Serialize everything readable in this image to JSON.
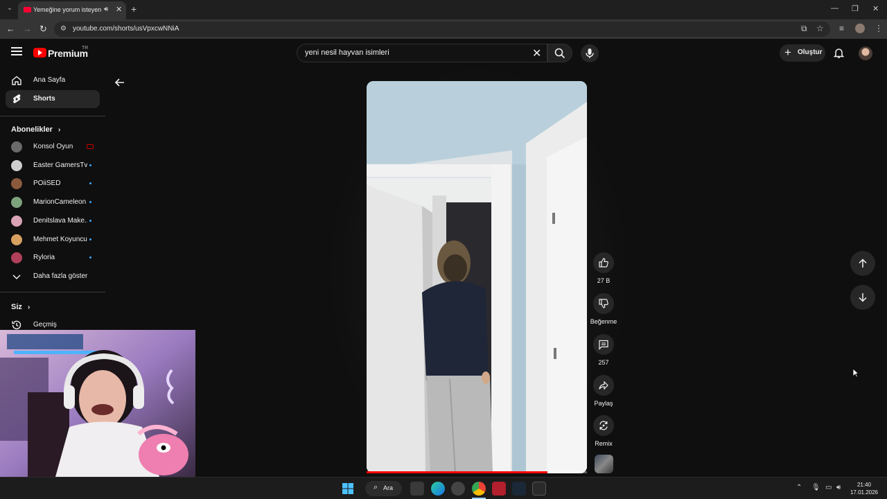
{
  "browser": {
    "tab_title": "Yemeğine yorum isteyen anne",
    "url": "youtube.com/shorts/usVpxcwNNiA"
  },
  "header": {
    "logo_text": "Premium",
    "logo_region": "TR",
    "search_value": "yeni nesil hayvan isimleri",
    "create_label": "Oluştur"
  },
  "sidebar": {
    "home_label": "Ana Sayfa",
    "shorts_label": "Shorts",
    "subscriptions_title": "Abonelikler",
    "subscriptions": [
      {
        "name": "Konsol Oyun",
        "status": "live",
        "color": "#6a6a6a"
      },
      {
        "name": "Easter GamersTv",
        "status": "new",
        "color": "#cfcfcf"
      },
      {
        "name": "POiiSED",
        "status": "new",
        "color": "#8b5a3c"
      },
      {
        "name": "MarionCameleon",
        "status": "new",
        "color": "#7da37d"
      },
      {
        "name": "Denitslava Make...",
        "status": "new",
        "color": "#d9a3b5"
      },
      {
        "name": "Mehmet Koyuncu",
        "status": "new",
        "color": "#d8a060"
      },
      {
        "name": "Ryloria",
        "status": "new",
        "color": "#b0405a"
      }
    ],
    "show_more_label": "Daha fazla göster",
    "you_title": "Siz",
    "history_label": "Geçmiş"
  },
  "short": {
    "progress_fraction": 0.82,
    "actions": {
      "like_count": "27 B",
      "dislike_label": "Beğenme",
      "comment_count": "257",
      "share_label": "Paylaş",
      "remix_label": "Remix"
    }
  },
  "taskbar": {
    "search_label": "Ara",
    "time": "21:40",
    "date": "17.01.2026"
  },
  "icons": [
    "hamburger-icon",
    "search-icon",
    "close-icon",
    "mic-icon",
    "plus-icon",
    "bell-icon",
    "home-icon",
    "shorts-icon",
    "chevron-right-icon",
    "chevron-down-icon",
    "history-icon",
    "back-arrow-icon",
    "like-icon",
    "dislike-icon",
    "comment-icon",
    "share-icon",
    "remix-icon",
    "arrow-up-icon",
    "arrow-down-icon"
  ]
}
